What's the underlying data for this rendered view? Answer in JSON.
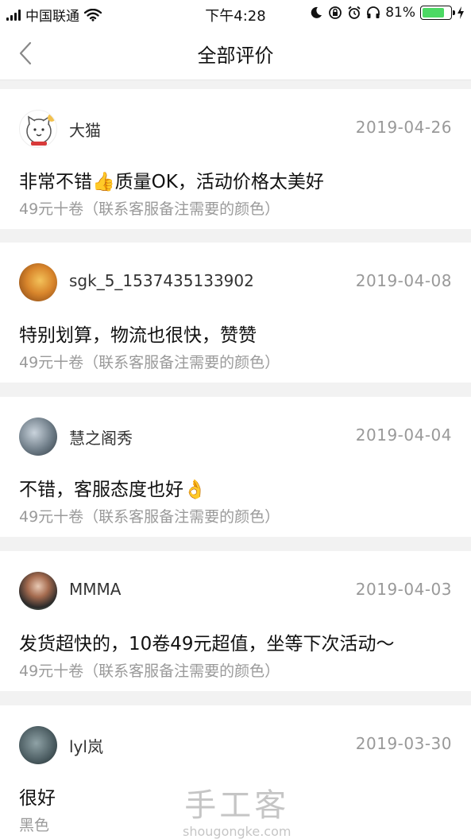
{
  "status_bar": {
    "carrier": "中国联通",
    "time": "下午4:28",
    "battery_percent": "81%",
    "battery_level": 0.81,
    "icons": [
      "signal-icon",
      "wifi-icon",
      "moon-icon",
      "rotation-lock-icon",
      "alarm-icon",
      "headphones-icon",
      "battery-icon",
      "charging-icon"
    ]
  },
  "nav": {
    "title": "全部评价",
    "back_icon": "chevron-left-icon"
  },
  "reviews": [
    {
      "user": "大猫",
      "date": "2019-04-26",
      "content": "非常不错👍质量OK，活动价格太美好",
      "spec": "49元十卷（联系客服备注需要的颜色）"
    },
    {
      "user": "sgk_5_1537435133902",
      "date": "2019-04-08",
      "content": "特别划算，物流也很快，赞赞",
      "spec": "49元十卷（联系客服备注需要的颜色）"
    },
    {
      "user": "慧之阁秀",
      "date": "2019-04-04",
      "content": "不错，客服态度也好👌",
      "spec": "49元十卷（联系客服备注需要的颜色）"
    },
    {
      "user": "MMMA",
      "date": "2019-04-03",
      "content": "发货超快的，10卷49元超值，坐等下次活动～",
      "spec": "49元十卷（联系客服备注需要的颜色）"
    },
    {
      "user": "lyl岚",
      "date": "2019-03-30",
      "content": "很好",
      "spec": "黑色"
    }
  ],
  "watermark": {
    "main": "手工客",
    "sub": "shougongke.com"
  },
  "colors": {
    "background": "#f2f2f2",
    "card": "#ffffff",
    "date_text": "#999999",
    "spec_text": "#9a9a9a",
    "battery_green": "#4cd964"
  }
}
